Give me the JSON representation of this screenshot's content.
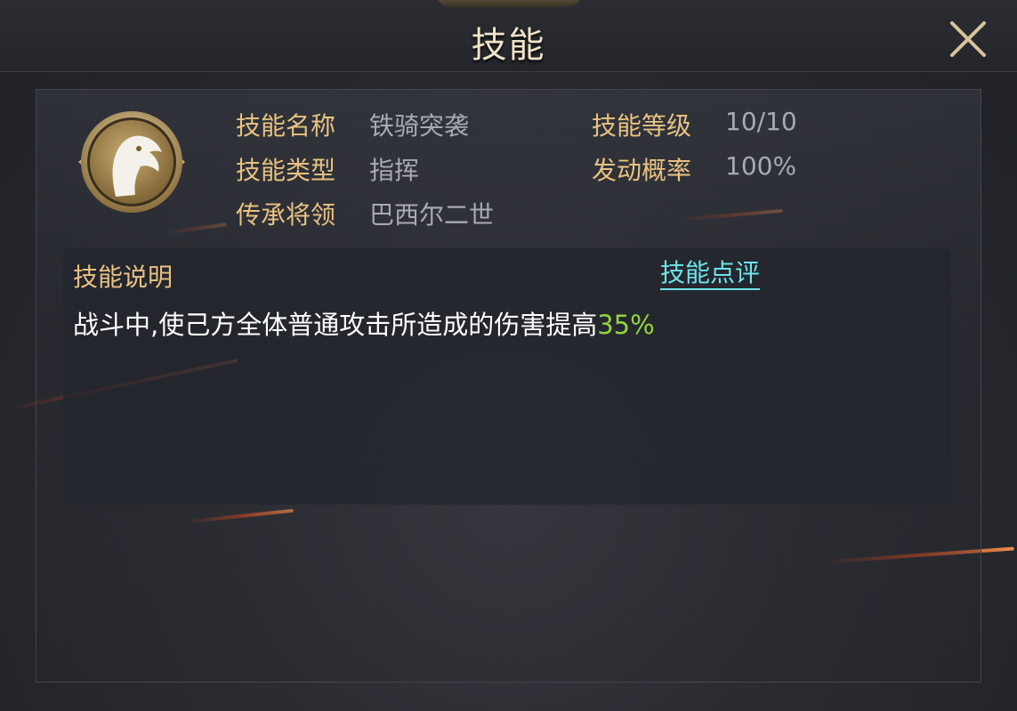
{
  "header": {
    "title": "技能"
  },
  "skill": {
    "name_label": "技能名称",
    "name": "铁骑突袭",
    "level_label": "技能等级",
    "level": "10/10",
    "type_label": "技能类型",
    "type": "指挥",
    "chance_label": "发动概率",
    "chance": "100%",
    "inherit_label": "传承将领",
    "inherit": "巴西尔二世",
    "icon": "horse-head-icon"
  },
  "description": {
    "title": "技能说明",
    "review_link": "技能点评",
    "text": "战斗中,使己方全体普通攻击所造成的伤害提高",
    "highlight": "35%",
    "highlight_color": "#94d33e"
  },
  "colors": {
    "label": "#e8c281",
    "value": "#a8aab1",
    "link": "#6fe3ea"
  }
}
